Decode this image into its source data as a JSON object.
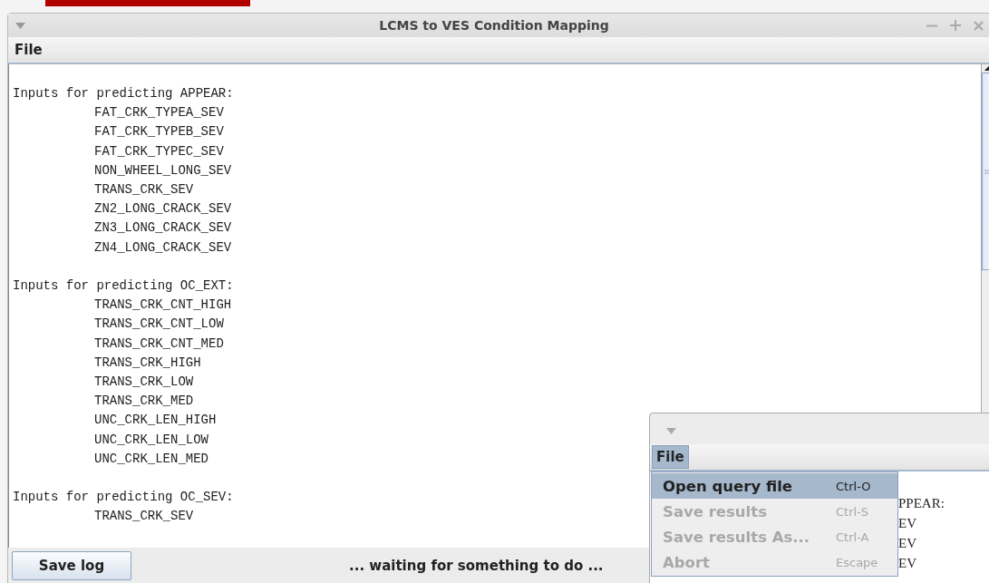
{
  "window": {
    "title": "LCMS to VES Condition Mapping"
  },
  "menu": [
    {
      "label": "File",
      "selected": false
    }
  ],
  "log": [
    {
      "heading": "Inputs for predicting APPEAR:",
      "inputs": [
        "FAT_CRK_TYPEA_SEV",
        "FAT_CRK_TYPEB_SEV",
        "FAT_CRK_TYPEC_SEV",
        "NON_WHEEL_LONG_SEV",
        "TRANS_CRK_SEV",
        "ZN2_LONG_CRACK_SEV",
        "ZN3_LONG_CRACK_SEV",
        "ZN4_LONG_CRACK_SEV"
      ]
    },
    {
      "heading": "Inputs for predicting OC_EXT:",
      "inputs": [
        "TRANS_CRK_CNT_HIGH",
        "TRANS_CRK_CNT_LOW",
        "TRANS_CRK_CNT_MED",
        "TRANS_CRK_HIGH",
        "TRANS_CRK_LOW",
        "TRANS_CRK_MED",
        "UNC_CRK_LEN_HIGH",
        "UNC_CRK_LEN_LOW",
        "UNC_CRK_LEN_MED"
      ]
    },
    {
      "heading": "Inputs for predicting OC_SEV:",
      "inputs": [
        "TRANS_CRK_SEV"
      ]
    }
  ],
  "bottom_bar": {
    "button": "Save log",
    "status": "... waiting for something to do ..."
  },
  "second_window": {
    "menu": [
      {
        "label": "File",
        "selected": true
      }
    ],
    "dropdown": [
      {
        "label": "Open query file",
        "shortcut": "Ctrl-O",
        "disabled": false,
        "selected": true
      },
      {
        "label": "Save results",
        "shortcut": "Ctrl-S",
        "disabled": true,
        "selected": false
      },
      {
        "label": "Save results As...",
        "shortcut": "Ctrl-A",
        "disabled": true,
        "selected": false
      },
      {
        "label": "Abort",
        "shortcut": "Escape",
        "disabled": true,
        "selected": false
      }
    ],
    "log_lines": [
      "PPEAR:",
      "EV",
      "EV",
      "EV"
    ]
  }
}
